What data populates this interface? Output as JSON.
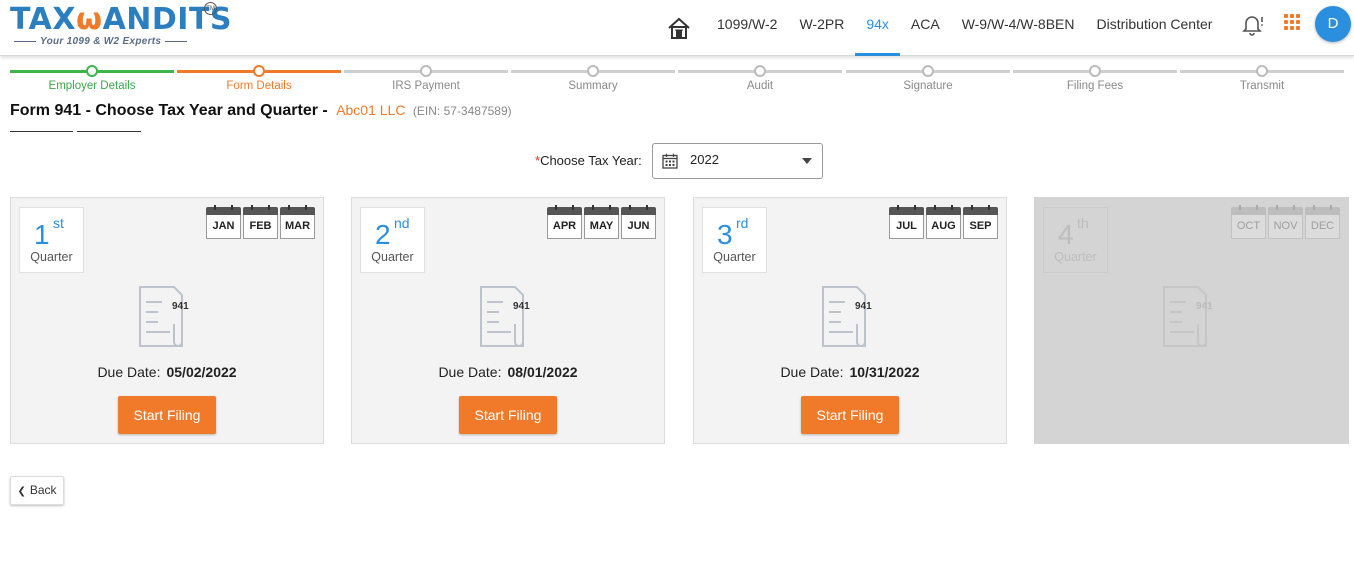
{
  "logo": {
    "main_left": "TAX",
    "main_owl": "ω",
    "main_right": "ANDITS",
    "tm": "TM",
    "tagline": "Your 1099 & W2 Experts"
  },
  "nav": {
    "home_icon": "house-icon",
    "items": [
      "1099/W-2",
      "W-2PR",
      "94x",
      "ACA",
      "W-9/W-4/W-8BEN",
      "Distribution Center"
    ],
    "active": "94x",
    "bell_icon": "bell-icon",
    "apps_icon": "grid-icon",
    "avatar_letter": "D"
  },
  "stepper": {
    "steps": [
      "Employer Details",
      "Form Details",
      "IRS Payment",
      "Summary",
      "Audit",
      "Signature",
      "Filing Fees",
      "Transmit"
    ],
    "done": "Employer Details",
    "current": "Form Details",
    "colors": {
      "done": "#3db54a",
      "current": "#f07a2a",
      "pending": "#cfcfcf"
    }
  },
  "page": {
    "title": "Form 941 - Choose Tax Year and Quarter -",
    "company": "Abc01 LLC",
    "ein": "(EIN: 57-3487589)"
  },
  "year": {
    "required_mark": "*",
    "label": "Choose Tax Year:",
    "value": "2022",
    "calendar_icon": "calendar-icon"
  },
  "quarters": [
    {
      "num": "1",
      "suffix": "st",
      "label": "Quarter",
      "months": [
        "JAN",
        "FEB",
        "MAR"
      ],
      "form": "941",
      "due_label": "Due Date:",
      "due_date": "05/02/2022",
      "button": "Start Filing"
    },
    {
      "num": "2",
      "suffix": "nd",
      "label": "Quarter",
      "months": [
        "APR",
        "MAY",
        "JUN"
      ],
      "form": "941",
      "due_label": "Due Date:",
      "due_date": "08/01/2022",
      "button": "Start Filing"
    },
    {
      "num": "3",
      "suffix": "rd",
      "label": "Quarter",
      "months": [
        "JUL",
        "AUG",
        "SEP"
      ],
      "form": "941",
      "due_label": "Due Date:",
      "due_date": "10/31/2022",
      "button": "Start Filing"
    },
    {
      "num": "4",
      "suffix": "th",
      "label": "Quarter",
      "months": [
        "OCT",
        "NOV",
        "DEC"
      ],
      "form": "941",
      "disabled": true
    }
  ],
  "back": {
    "label": "Back",
    "icon": "chevron-left-icon"
  },
  "colors": {
    "brand_blue": "#2b8fe0",
    "brand_orange": "#f07a2a"
  }
}
